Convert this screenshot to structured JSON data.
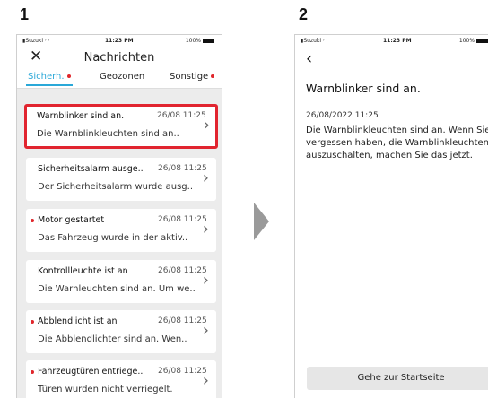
{
  "steps": [
    "1",
    "2"
  ],
  "status": {
    "carrier": "Suzuki",
    "time": "11:23 PM",
    "battery": "100%"
  },
  "screen1": {
    "title": "Nachrichten",
    "tabs": [
      {
        "label": "Sicherh.",
        "dot": true,
        "active": true
      },
      {
        "label": "Geozonen",
        "dot": false,
        "active": false
      },
      {
        "label": "Sonstige",
        "dot": true,
        "active": false
      }
    ],
    "items": [
      {
        "title": "Warnblinker sind an.",
        "date": "26/08 11:25",
        "message": "Die Warnblinkleuchten sind an..",
        "unread": false,
        "selected": true
      },
      {
        "title": "Sicherheitsalarm ausge..",
        "date": "26/08 11:25",
        "message": "Der Sicherheitsalarm wurde ausg..",
        "unread": false,
        "selected": false
      },
      {
        "title": "Motor gestartet",
        "date": "26/08 11:25",
        "message": "Das Fahrzeug wurde in der aktiv..",
        "unread": true,
        "selected": false
      },
      {
        "title": "Kontrollleuchte ist an",
        "date": "26/08 11:25",
        "message": "Die Warnleuchten sind an. Um we..",
        "unread": false,
        "selected": false
      },
      {
        "title": "Abblendlicht ist an",
        "date": "26/08 11:25",
        "message": "Die Abblendlichter sind an. Wen..",
        "unread": true,
        "selected": false
      },
      {
        "title": "Fahrzeugtüren entriege..",
        "date": "26/08 11:25",
        "message": "Türen wurden nicht verriegelt.",
        "unread": true,
        "selected": false
      }
    ]
  },
  "screen2": {
    "title": "Warnblinker sind an.",
    "date": "26/08/2022 11:25",
    "body": "Die Warnblinkleuchten sind an. Wenn Sie vergessen haben, die Warnblinkleuchten auszuschalten, machen Sie das jetzt.",
    "home_button": "Gehe zur Startseite"
  },
  "colors": {
    "accent": "#2aa8d8",
    "alert": "#e0262b",
    "highlight": "#e1242f"
  }
}
